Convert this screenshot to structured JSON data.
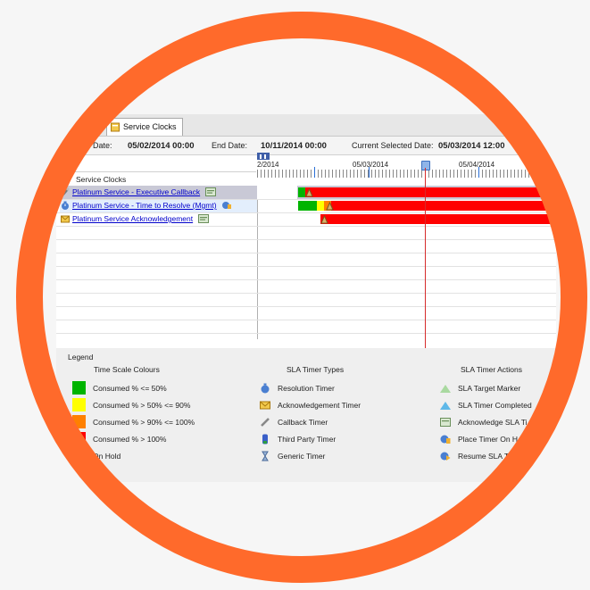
{
  "tab": {
    "label": "Service Clocks"
  },
  "dates": {
    "start_label": "Date:",
    "start_value": "05/02/2014 00:00",
    "end_label": "End Date:",
    "end_value": "10/11/2014 00:00",
    "current_label": "Current Selected Date:",
    "current_value": "05/03/2014 12:00"
  },
  "timeline": {
    "labels": [
      "2/2014",
      "05/03/2014",
      "05/04/2014"
    ]
  },
  "grid": {
    "column_header": "Service Clocks",
    "rows": [
      {
        "label": "Platinum Service - Executive Callback",
        "icon": "callback-timer-icon",
        "action_icon": "acknowledge-sla-timer-icon"
      },
      {
        "label": "Platinum Service - Time to Resolve (Mgmt)",
        "icon": "resolution-timer-icon",
        "action_icon": "place-timer-on-hold-icon"
      },
      {
        "label": "Platinum Service Acknowledgement",
        "icon": "acknowledgement-timer-icon",
        "action_icon": "acknowledge-sla-timer-icon"
      }
    ]
  },
  "legend": {
    "title": "Legend",
    "colours_header": "Time Scale Colours",
    "types_header": "SLA Timer Types",
    "actions_header": "SLA Timer Actions",
    "colours": [
      {
        "label": "Consumed % <= 50%",
        "color": "#00b400"
      },
      {
        "label": "Consumed % > 50% <= 90%",
        "color": "#ffff00"
      },
      {
        "label": "Consumed % > 90% <= 100%",
        "color": "#ff8000"
      },
      {
        "label": "Consumed % > 100%",
        "color": "#ff0000"
      },
      {
        "label": "On Hold",
        "color": "#ffffff"
      }
    ],
    "types": [
      {
        "label": "Resolution Timer",
        "icon": "resolution-timer-icon"
      },
      {
        "label": "Acknowledgement Timer",
        "icon": "acknowledgement-timer-icon"
      },
      {
        "label": "Callback Timer",
        "icon": "callback-timer-icon"
      },
      {
        "label": "Third Party Timer",
        "icon": "third-party-timer-icon"
      },
      {
        "label": "Generic Timer",
        "icon": "generic-timer-icon"
      }
    ],
    "actions": [
      {
        "label": "SLA Target Marker",
        "icon": "sla-target-marker-icon"
      },
      {
        "label": "SLA Timer Completed",
        "icon": "sla-timer-completed-icon"
      },
      {
        "label": "Acknowledge SLA Ti",
        "icon": "acknowledge-sla-timer-icon"
      },
      {
        "label": "Place Timer On H",
        "icon": "place-timer-on-hold-icon"
      },
      {
        "label": "Resume SLA T",
        "icon": "resume-sla-timer-icon"
      }
    ]
  },
  "colors": {
    "ring": "#ff6a2b",
    "link": "#0000cc",
    "row_selected": "#c7c7d4",
    "row_highlight": "#e3eefc"
  }
}
